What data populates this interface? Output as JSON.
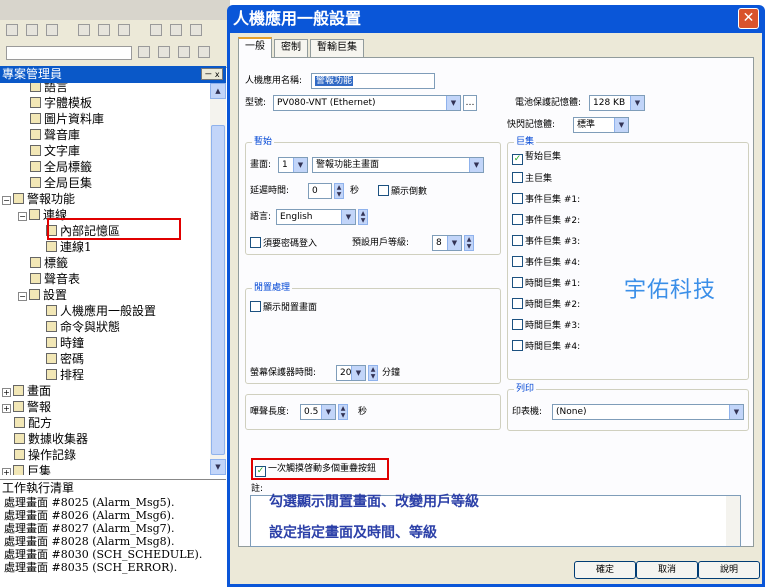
{
  "project_manager": {
    "title": "專案管理員",
    "close": "ㄧ x",
    "tree": [
      {
        "label": "語言",
        "depth": 2,
        "pm": ""
      },
      {
        "label": "字體模板",
        "depth": 2,
        "pm": ""
      },
      {
        "label": "圖片資料庫",
        "depth": 2,
        "pm": ""
      },
      {
        "label": "聲音庫",
        "depth": 2,
        "pm": ""
      },
      {
        "label": "文字庫",
        "depth": 2,
        "pm": ""
      },
      {
        "label": "全局標籤",
        "depth": 2,
        "pm": ""
      },
      {
        "label": "全局巨集",
        "depth": 2,
        "pm": ""
      },
      {
        "label": "警報功能",
        "depth": 1,
        "pm": "−"
      },
      {
        "label": "連線",
        "depth": 2,
        "pm": "−"
      },
      {
        "label": "內部記憶區",
        "depth": 3,
        "pm": ""
      },
      {
        "label": "連線1",
        "depth": 3,
        "pm": ""
      },
      {
        "label": "標籤",
        "depth": 2,
        "pm": ""
      },
      {
        "label": "聲音表",
        "depth": 2,
        "pm": ""
      },
      {
        "label": "設置",
        "depth": 2,
        "pm": "−"
      },
      {
        "label": "人機應用一般設置",
        "depth": 3,
        "pm": ""
      },
      {
        "label": "命令與狀態",
        "depth": 3,
        "pm": ""
      },
      {
        "label": "時鐘",
        "depth": 3,
        "pm": ""
      },
      {
        "label": "密碼",
        "depth": 3,
        "pm": ""
      },
      {
        "label": "排程",
        "depth": 3,
        "pm": ""
      },
      {
        "label": "畫面",
        "depth": 1,
        "pm": "+"
      },
      {
        "label": "警報",
        "depth": 1,
        "pm": "+"
      },
      {
        "label": "配方",
        "depth": 1,
        "pm": ""
      },
      {
        "label": "數據收集器",
        "depth": 1,
        "pm": ""
      },
      {
        "label": "操作記錄",
        "depth": 1,
        "pm": ""
      },
      {
        "label": "巨集",
        "depth": 1,
        "pm": "+"
      }
    ]
  },
  "task_list": {
    "title": "工作執行清單",
    "items": [
      "處理畫面 #8025 (Alarm_Msg5).",
      "處理畫面 #8026 (Alarm_Msg6).",
      "處理畫面 #8027 (Alarm_Msg7).",
      "處理畫面 #8028 (Alarm_Msg8).",
      "處理畫面 #8030 (SCH_SCHEDULE).",
      "處理畫面 #8035 (SCH_ERROR)."
    ]
  },
  "dialog": {
    "title": "人機應用一般設置",
    "close": "✕",
    "tabs": [
      "一般",
      "密制",
      "暫輸巨集"
    ],
    "app_name_label": "人機應用名稱:",
    "app_name_value": "警報功能",
    "model_label": "型號:",
    "model_value": "PV080-VNT (Ethernet)",
    "battery_label": "電池保護記憶體:",
    "battery_value": "128 KB",
    "flash_label": "快閃記憶體:",
    "flash_value": "標準",
    "start_group": "暫始",
    "screen_label": "畫面:",
    "screen_num": "1",
    "screen_name": "警報功能主畫面",
    "delay_label": "延遲時間:",
    "delay_value": "0",
    "delay_unit": "秒",
    "countdown_label": "顯示倒數",
    "lang_label": "語言:",
    "lang_value": "English",
    "password_label": "須要密碼登入",
    "user_level_label": "預設用戶等級:",
    "user_level_value": "8",
    "idle_group": "閒置處理",
    "idle_label": "顯示閒置畫面",
    "saver_label": "螢幕保護器時間:",
    "saver_value": "20",
    "saver_unit": "分鐘",
    "buzzer_label": "嗶聲長度:",
    "buzzer_value": "0.5",
    "buzzer_unit": "秒",
    "macro_group": "巨集",
    "macros": [
      {
        "label": "暫始巨集",
        "checked": true
      },
      {
        "label": "主巨集",
        "checked": false
      },
      {
        "label": "事件巨集 #1:",
        "checked": false
      },
      {
        "label": "事件巨集 #2:",
        "checked": false
      },
      {
        "label": "事件巨集 #3:",
        "checked": false
      },
      {
        "label": "事件巨集 #4:",
        "checked": false
      },
      {
        "label": "時間巨集 #1:",
        "checked": false
      },
      {
        "label": "時間巨集 #2:",
        "checked": false
      },
      {
        "label": "時間巨集 #3:",
        "checked": false
      },
      {
        "label": "時間巨集 #4:",
        "checked": false
      }
    ],
    "print_group": "列印",
    "printer_label": "印表機:",
    "printer_value": "(None)",
    "multi_touch_label": "一次觸摸啓動多個重疊按鈕",
    "notes_label": "註:",
    "ok": "確定",
    "cancel": "取消",
    "help": "說明"
  },
  "annotations": {
    "brand": "宇佑科技",
    "line1": "勾選顯示閒置畫面、改變用戶等級",
    "line2": "設定指定畫面及時間、等級"
  }
}
